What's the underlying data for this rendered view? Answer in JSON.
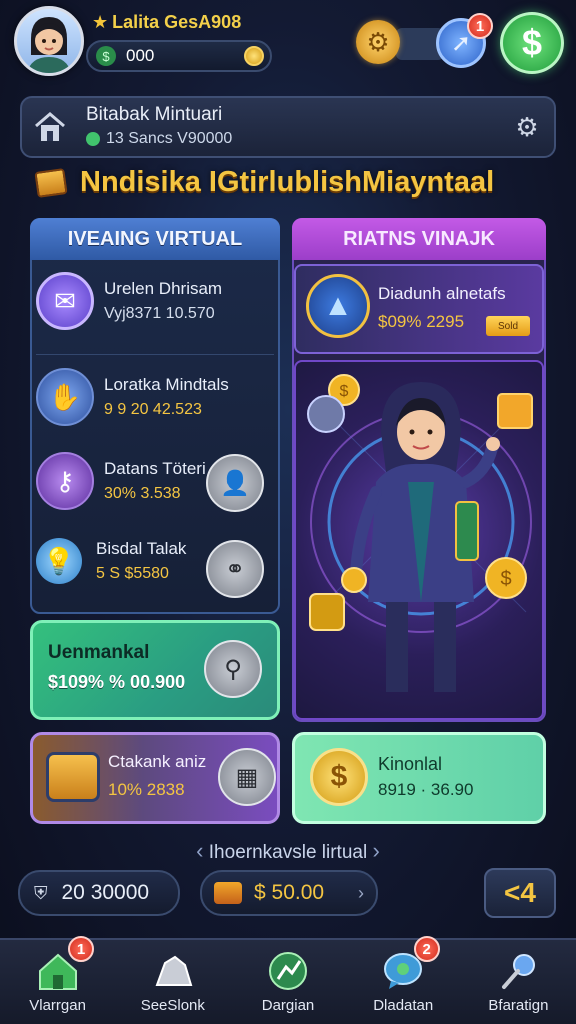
{
  "player": {
    "name": "Lalita GesA908",
    "cash": "000"
  },
  "top_actions": {
    "notifications_badge": "1"
  },
  "header": {
    "title": "Bitabak Mintuari",
    "subtitle": "13 Sancs V90000"
  },
  "main_title": "Nndisika IGtirlublishMiayntaal",
  "left_panel": {
    "heading": "IVEAING VIRTUAL",
    "items": [
      {
        "title": "Urelen Dhrisam",
        "value": "Vyj8371 10.570"
      },
      {
        "title": "Loratka Mindtals",
        "value": "9 9 20 42.523"
      },
      {
        "title": "Datans Töteri",
        "value": "30% 3.538"
      },
      {
        "title": "Bisdal Talak",
        "value": "5 S $5580"
      }
    ]
  },
  "green_card": {
    "title": "Uenmankal",
    "value": "$109% % 00.900"
  },
  "right_panel": {
    "heading": "RIATNS VINAJK",
    "top_card": {
      "title": "Diadunh alnetafs",
      "value": "$09% 2295",
      "tag": "Sold"
    }
  },
  "purple_card": {
    "title": "Ctakank aniz",
    "value": "10% 2838"
  },
  "mint_card": {
    "title": "Kinonlal",
    "value": "8919 · 36.90"
  },
  "pager": {
    "label": "Ihoernkavsle lirtual"
  },
  "bottom_bar": {
    "left_value": "20 30000",
    "mid_value": "$ 50.00",
    "back_label": "<4"
  },
  "nav": [
    {
      "label": "Vlarrgan",
      "badge": "1"
    },
    {
      "label": "SeeSlonk",
      "badge": ""
    },
    {
      "label": "Dargian",
      "badge": ""
    },
    {
      "label": "Dladatan",
      "badge": "2"
    },
    {
      "label": "Bfaratign",
      "badge": ""
    }
  ],
  "colors": {
    "accent_gold": "#f4c542",
    "left_header": "#4f7fd3",
    "right_header": "#c35ae6",
    "green_card": "#34c07d",
    "mint_card": "#7fe6b2"
  },
  "icons": {
    "top": [
      "player-avatar",
      "star-icon",
      "dollar-icon",
      "coin-icon",
      "gear-icon",
      "compass-icon",
      "cash-icon"
    ],
    "header": [
      "home-icon",
      "settings-icon"
    ],
    "left_items": [
      "mail-icon",
      "handshake-icon",
      "key-icon",
      "lightbulb-icon"
    ]
  }
}
